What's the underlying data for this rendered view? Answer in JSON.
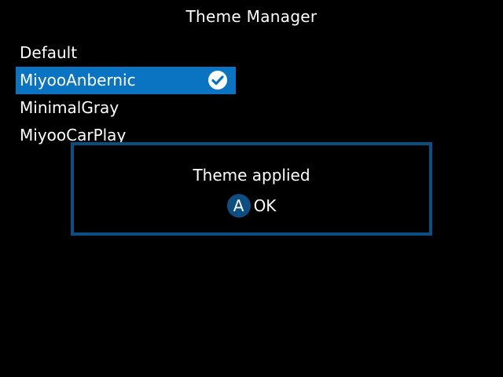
{
  "header": {
    "title": "Theme Manager"
  },
  "themes": [
    {
      "label": "Default",
      "selected": false
    },
    {
      "label": "MiyooAnbernic",
      "selected": true
    },
    {
      "label": "MinimalGray",
      "selected": false
    },
    {
      "label": "MiyooCarPlay",
      "selected": false
    }
  ],
  "dialog": {
    "message": "Theme applied",
    "button_glyph": "A",
    "button_label": "OK"
  },
  "icons": {
    "selected_marker": "check-circle-icon"
  },
  "colors": {
    "background": "#000000",
    "selection": "#0a73c2",
    "dialog_border": "#0b4f82",
    "button_circle": "#0b4f82",
    "text": "#ffffff"
  }
}
